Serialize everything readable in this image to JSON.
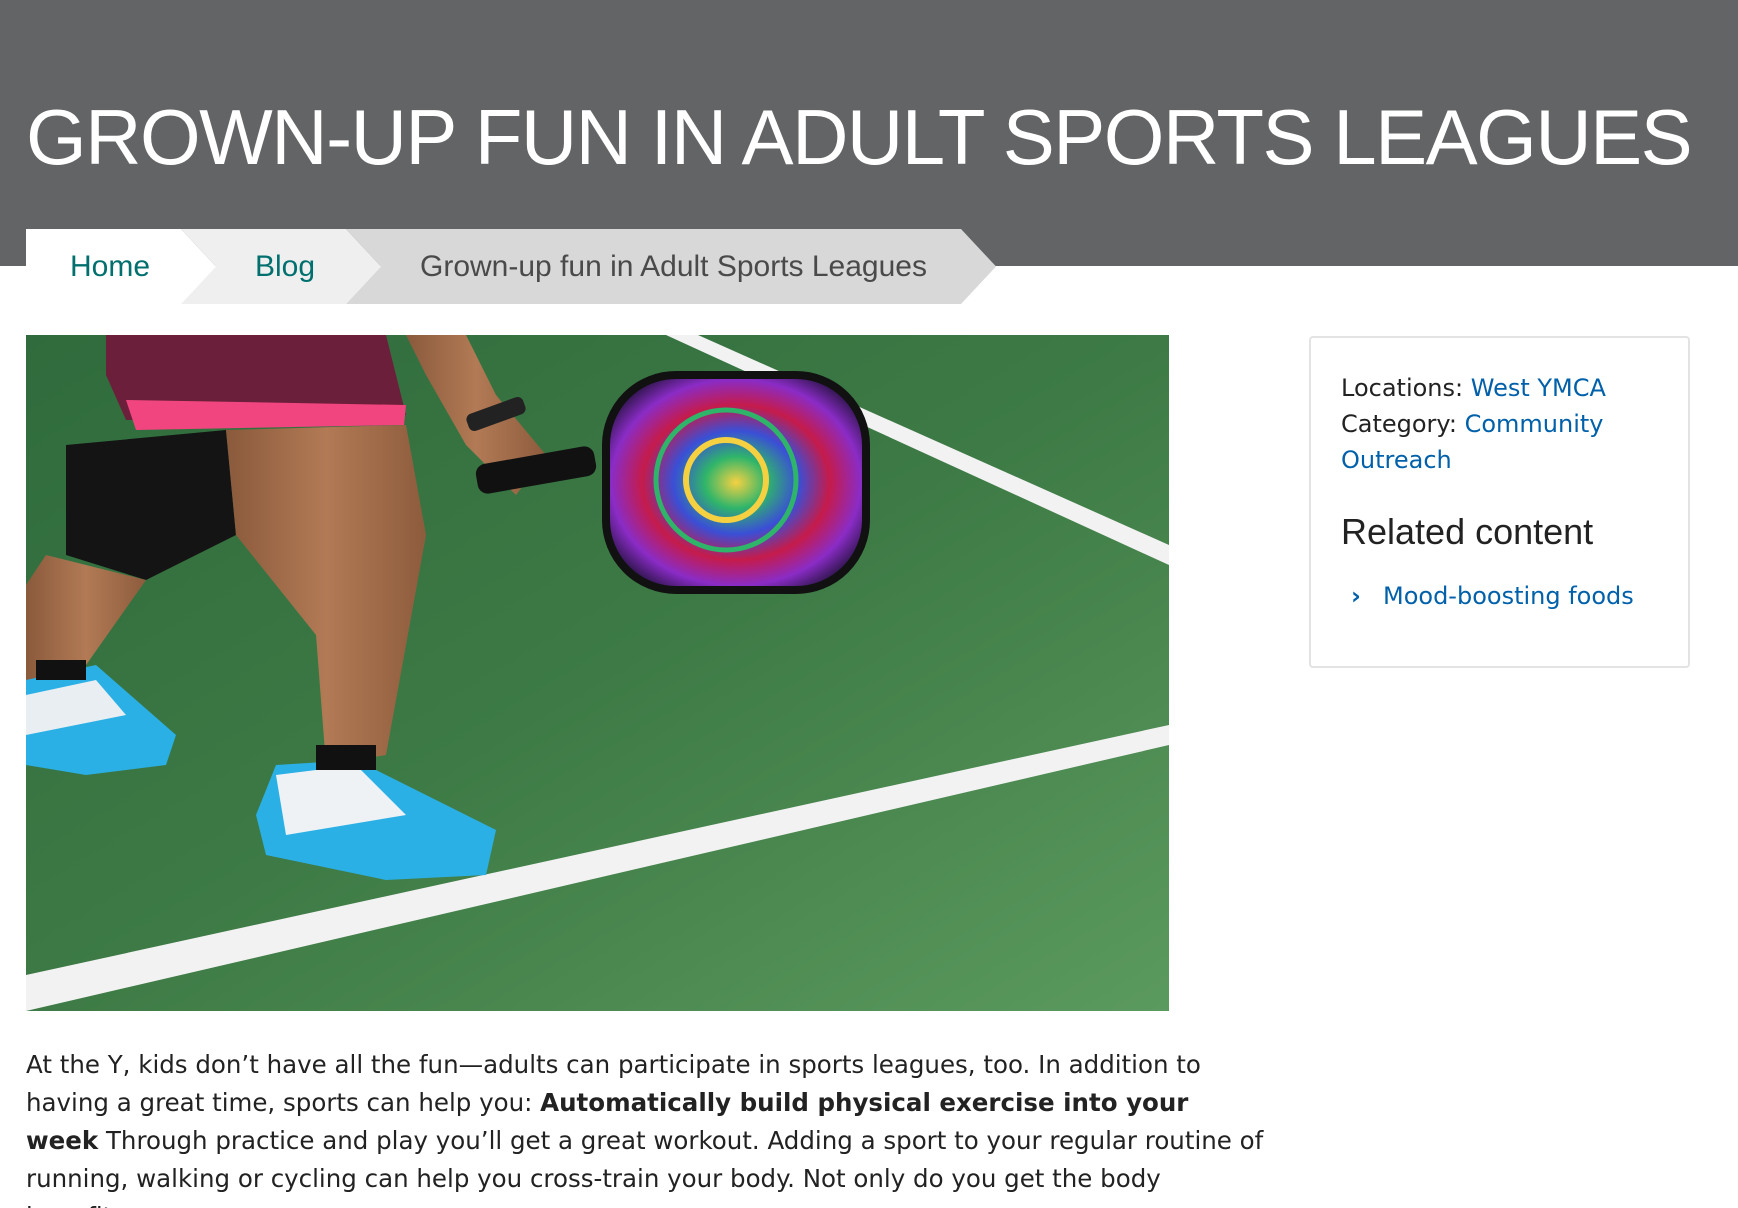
{
  "header": {
    "title": "GROWN-UP FUN IN ADULT SPORTS LEAGUES"
  },
  "breadcrumb": {
    "items": [
      {
        "label": "Home"
      },
      {
        "label": "Blog"
      },
      {
        "label": "Grown-up fun in Adult Sports Leagues"
      }
    ]
  },
  "hero": {
    "alt": "Pickleball player holding a colorful paddle on a green court",
    "icon": "pickleball-photo"
  },
  "article": {
    "p1_start": "At the Y, kids don’t have all the fun—adults can participate in sports leagues, too. In addition to having a great time, sports can help you: ",
    "p1_bold": "Automatically build physical exercise into your week",
    "p1_end": " Through practice and play you’ll get a great workout. Adding a sport to your regular routine of running, walking or cycling can help you cross-train your body. Not only do you get the body benefits"
  },
  "sidebar": {
    "locations_label": "Locations:",
    "locations_value": "West YMCA",
    "category_label": "Category:",
    "category_value": "Community Outreach",
    "related_title": "Related content",
    "related_items": [
      {
        "label": "Mood-boosting foods",
        "icon": "chevron-right-icon"
      }
    ]
  },
  "colors": {
    "header_bg": "#636466",
    "link": "#0060a9",
    "breadcrumb_link": "#00706e"
  }
}
